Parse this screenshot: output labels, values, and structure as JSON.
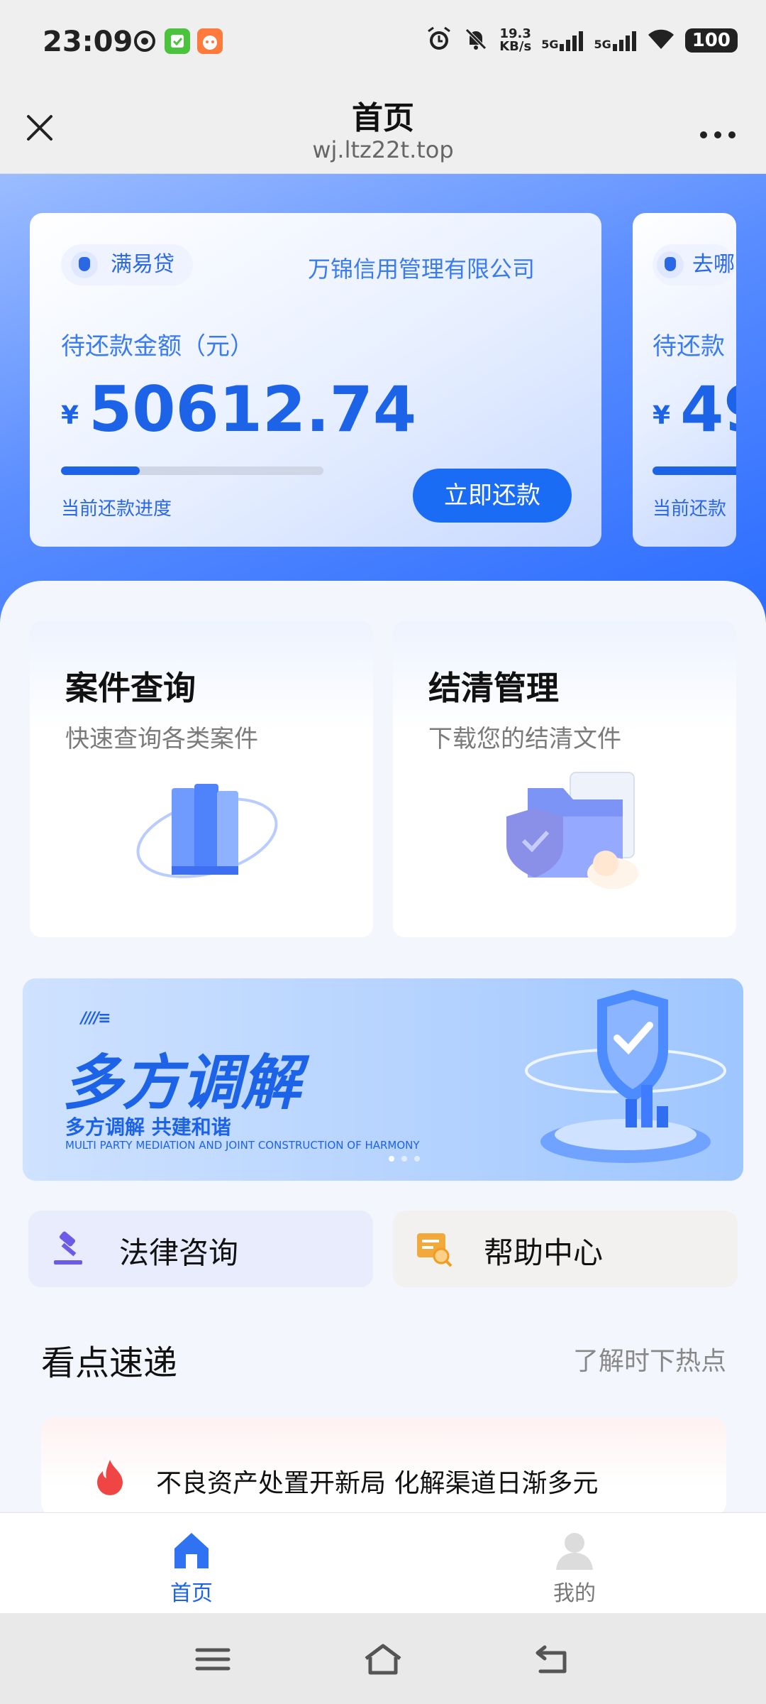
{
  "status_bar": {
    "time": "23:09",
    "net_speed_value": "19.3",
    "net_speed_unit": "KB/s",
    "signal1": "5G",
    "signal2": "5G",
    "battery": "100",
    "icons": [
      "sync-icon",
      "wechat-icon",
      "app-icon",
      "alarm-icon",
      "mute-icon",
      "wifi-icon"
    ]
  },
  "title_bar": {
    "title": "首页",
    "url": "wj.ltz22t.top"
  },
  "loan_card": {
    "lender": "满易贷",
    "company": "万锦信用管理有限公司",
    "due_label": "待还款金额（元）",
    "currency": "¥",
    "amount": "50612.74",
    "progress_fraction": 0.3,
    "progress_label": "当前还款进度",
    "repay_button": "立即还款"
  },
  "loan_card_peek": {
    "lender": "去哪",
    "due_label": "待还款",
    "currency": "¥",
    "amount": "49",
    "progress_label": "当前还款"
  },
  "tiles": [
    {
      "title": "案件查询",
      "subtitle": "快速查询各类案件",
      "icon": "books-icon"
    },
    {
      "title": "结清管理",
      "subtitle": "下载您的结清文件",
      "icon": "folder-icon"
    }
  ],
  "banner": {
    "stripes": "////≡",
    "title": "多方调解",
    "subtitle": "多方调解 共建和谐",
    "english": "MULTI PARTY MEDIATION AND JOINT CONSTRUCTION OF HARMONY",
    "slides": 3,
    "active_slide": 1
  },
  "quick_links": [
    {
      "label": "法律咨询",
      "icon": "gavel-icon"
    },
    {
      "label": "帮助中心",
      "icon": "help-doc-icon"
    }
  ],
  "news": {
    "title": "看点速递",
    "more": "了解时下热点",
    "items": [
      {
        "text": "不良资产处置开新局 化解渠道日渐多元",
        "icon": "fire-icon"
      }
    ]
  },
  "bottom_nav": [
    {
      "label": "首页",
      "icon": "home-icon",
      "active": true
    },
    {
      "label": "我的",
      "icon": "user-icon",
      "active": false
    }
  ],
  "colors": {
    "primary": "#1c63e8",
    "button": "#1a6cf5",
    "hero_start": "#9bbcff",
    "hero_end": "#2a6cff",
    "page_bg": "#f3f6fd"
  }
}
